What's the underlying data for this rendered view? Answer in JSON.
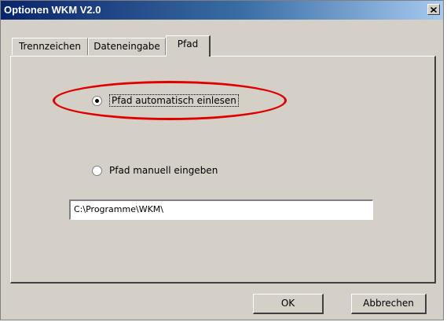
{
  "window": {
    "title": "Optionen WKM V2.0",
    "close_glyph": "×"
  },
  "tabs": [
    {
      "label": "Trennzeichen",
      "active": false
    },
    {
      "label": "Dateneingabe",
      "active": false
    },
    {
      "label": "Pfad",
      "active": true
    }
  ],
  "path_tab": {
    "radio_auto": {
      "label": "Pfad automatisch einlesen",
      "checked": true
    },
    "radio_manual": {
      "label": "Pfad manuell eingeben",
      "checked": false
    },
    "path_field": {
      "value": "C:\\Programme\\WKM\\"
    }
  },
  "buttons": {
    "ok_label": "OK",
    "cancel_label": "Abbrechen"
  },
  "colors": {
    "annotation_ellipse": "#e00000",
    "titlebar_start": "#0a246a",
    "dialog_background": "#d4d0c8"
  }
}
